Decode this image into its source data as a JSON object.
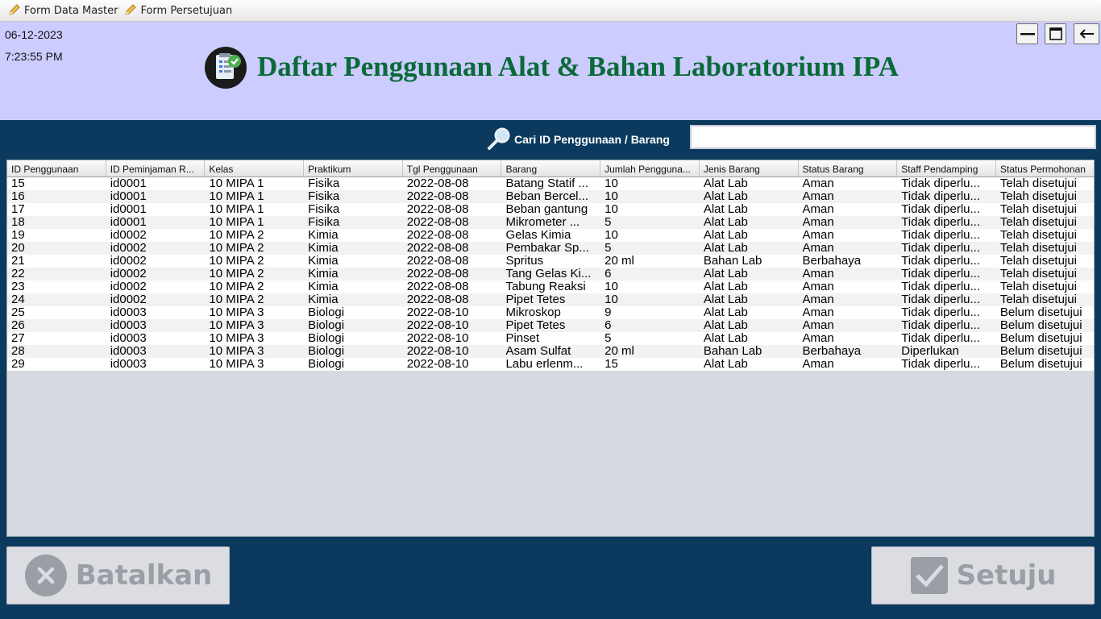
{
  "menu": {
    "items": [
      {
        "label": "Form Data Master"
      },
      {
        "label": "Form Persetujuan"
      }
    ]
  },
  "header": {
    "date": "06-12-2023",
    "time": "7:23:55 PM",
    "title": "Daftar Penggunaan Alat & Bahan Laboratorium IPA"
  },
  "search": {
    "label": "Cari ID Penggunaan / Barang",
    "value": ""
  },
  "table": {
    "columns": [
      "ID Penggunaan",
      "ID Peminjaman R...",
      "Kelas",
      "Praktikum",
      "Tgl Penggunaan",
      "Barang",
      "Jumlah Pengguna...",
      "Jenis Barang",
      "Status Barang",
      "Staff Pendamping",
      "Status Permohonan"
    ],
    "rows": [
      [
        "15",
        "id0001",
        "10 MIPA 1",
        "Fisika",
        "2022-08-08",
        "Batang Statif ...",
        "10",
        "Alat Lab",
        "Aman",
        "Tidak diperlu...",
        "Telah disetujui"
      ],
      [
        "16",
        "id0001",
        "10 MIPA 1",
        "Fisika",
        "2022-08-08",
        "Beban Bercel...",
        "10",
        "Alat Lab",
        "Aman",
        "Tidak diperlu...",
        "Telah disetujui"
      ],
      [
        "17",
        "id0001",
        "10 MIPA 1",
        "Fisika",
        "2022-08-08",
        "Beban gantung",
        "10",
        "Alat Lab",
        "Aman",
        "Tidak diperlu...",
        "Telah disetujui"
      ],
      [
        "18",
        "id0001",
        "10 MIPA 1",
        "Fisika",
        "2022-08-08",
        "Mikrometer ...",
        "5",
        "Alat Lab",
        "Aman",
        "Tidak diperlu...",
        "Telah disetujui"
      ],
      [
        "19",
        "id0002",
        "10 MIPA 2",
        "Kimia",
        "2022-08-08",
        "Gelas Kimia",
        "10",
        "Alat Lab",
        "Aman",
        "Tidak diperlu...",
        "Telah disetujui"
      ],
      [
        "20",
        "id0002",
        "10 MIPA 2",
        "Kimia",
        "2022-08-08",
        "Pembakar Sp...",
        "5",
        "Alat Lab",
        "Aman",
        "Tidak diperlu...",
        "Telah disetujui"
      ],
      [
        "21",
        "id0002",
        "10 MIPA 2",
        "Kimia",
        "2022-08-08",
        "Spritus",
        "20 ml",
        "Bahan Lab",
        "Berbahaya",
        "Tidak diperlu...",
        "Telah disetujui"
      ],
      [
        "22",
        "id0002",
        "10 MIPA 2",
        "Kimia",
        "2022-08-08",
        "Tang Gelas Ki...",
        "6",
        "Alat Lab",
        "Aman",
        "Tidak diperlu...",
        "Telah disetujui"
      ],
      [
        "23",
        "id0002",
        "10 MIPA 2",
        "Kimia",
        "2022-08-08",
        "Tabung Reaksi",
        "10",
        "Alat Lab",
        "Aman",
        "Tidak diperlu...",
        "Telah disetujui"
      ],
      [
        "24",
        "id0002",
        "10 MIPA 2",
        "Kimia",
        "2022-08-08",
        "Pipet Tetes",
        "10",
        "Alat Lab",
        "Aman",
        "Tidak diperlu...",
        "Telah disetujui"
      ],
      [
        "25",
        "id0003",
        "10 MIPA 3",
        "Biologi",
        "2022-08-10",
        "Mikroskop",
        "9",
        "Alat Lab",
        "Aman",
        "Tidak diperlu...",
        "Belum disetujui"
      ],
      [
        "26",
        "id0003",
        "10 MIPA 3",
        "Biologi",
        "2022-08-10",
        "Pipet Tetes",
        "6",
        "Alat Lab",
        "Aman",
        "Tidak diperlu...",
        "Belum disetujui"
      ],
      [
        "27",
        "id0003",
        "10 MIPA 3",
        "Biologi",
        "2022-08-10",
        "Pinset",
        "5",
        "Alat Lab",
        "Aman",
        "Tidak diperlu...",
        "Belum disetujui"
      ],
      [
        "28",
        "id0003",
        "10 MIPA 3",
        "Biologi",
        "2022-08-10",
        "Asam Sulfat",
        "20 ml",
        "Bahan Lab",
        "Berbahaya",
        "Diperlukan",
        "Belum disetujui"
      ],
      [
        "29",
        "id0003",
        "10 MIPA 3",
        "Biologi",
        "2022-08-10",
        "Labu erlenm...",
        "15",
        "Alat Lab",
        "Aman",
        "Tidak diperlu...",
        "Belum disetujui"
      ]
    ]
  },
  "buttons": {
    "cancel": "Batalkan",
    "approve": "Setuju"
  },
  "colors": {
    "background": "#0b3a5e",
    "header": "#ccccff",
    "title": "#0a6a3a",
    "button_text_disabled": "#9b9ea4"
  },
  "icons": [
    "edit-icon",
    "document-check-icon",
    "minimize-icon",
    "maximize-icon",
    "back-arrow-icon",
    "magnifier-icon",
    "close-circle-icon",
    "checkbox-icon"
  ]
}
